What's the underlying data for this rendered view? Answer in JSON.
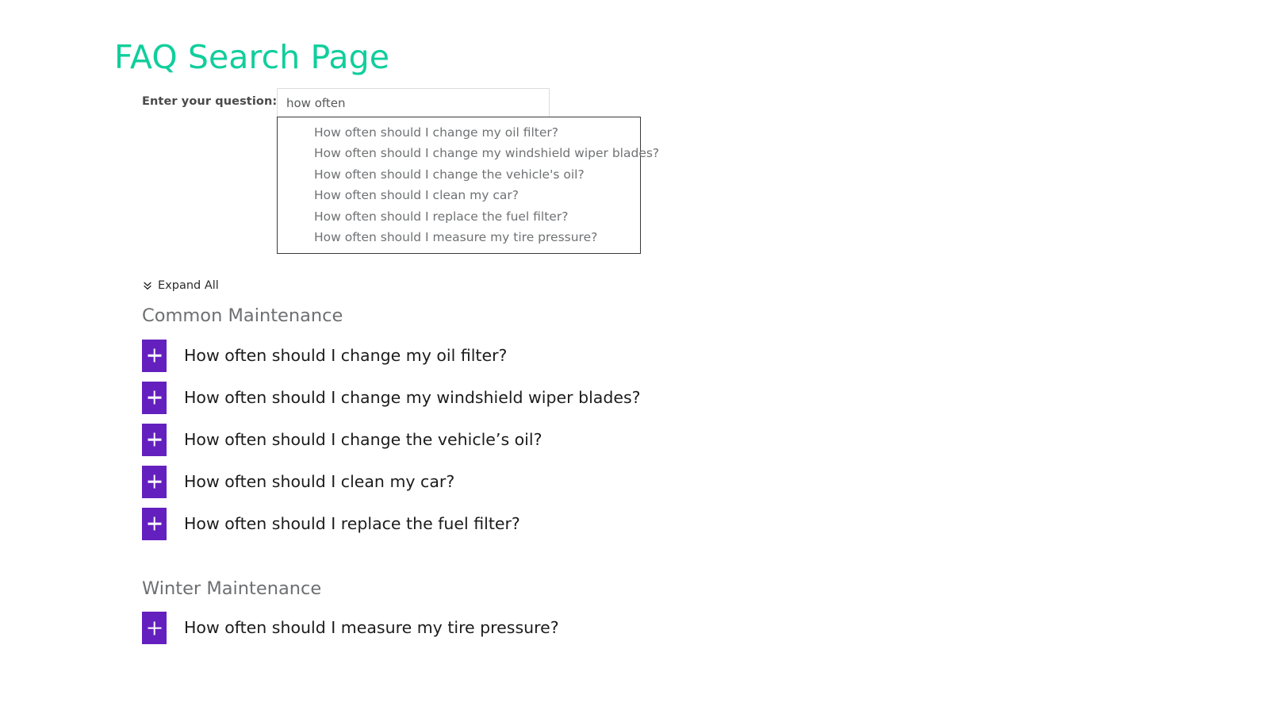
{
  "page": {
    "title": "FAQ Search Page",
    "title_color": "#10ce9c"
  },
  "search": {
    "label": "Enter your question:",
    "value": "how often",
    "placeholder": "",
    "suggestions": [
      "How often should I change my oil filter?",
      "How often should I change my windshield wiper blades?",
      "How often should I change the vehicle's oil?",
      "How often should I clean my car?",
      "How often should I replace the fuel filter?",
      "How often should I measure my tire pressure?"
    ]
  },
  "expand_all": {
    "label": "Expand All",
    "icon": "double-chevron-down-icon"
  },
  "faq": {
    "toggle_icon": "plus-icon",
    "toggle_color": "#6420be",
    "groups": [
      {
        "title": "Common Maintenance",
        "items": [
          {
            "question": "How often should I change my oil filter?"
          },
          {
            "question": "How often should I change my windshield wiper blades?"
          },
          {
            "question": "How often should I change the vehicle’s oil?"
          },
          {
            "question": "How often should I clean my car?"
          },
          {
            "question": "How often should I replace the fuel filter?"
          }
        ]
      },
      {
        "title": "Winter Maintenance",
        "items": [
          {
            "question": "How often should I measure my tire pressure?"
          }
        ]
      }
    ]
  }
}
